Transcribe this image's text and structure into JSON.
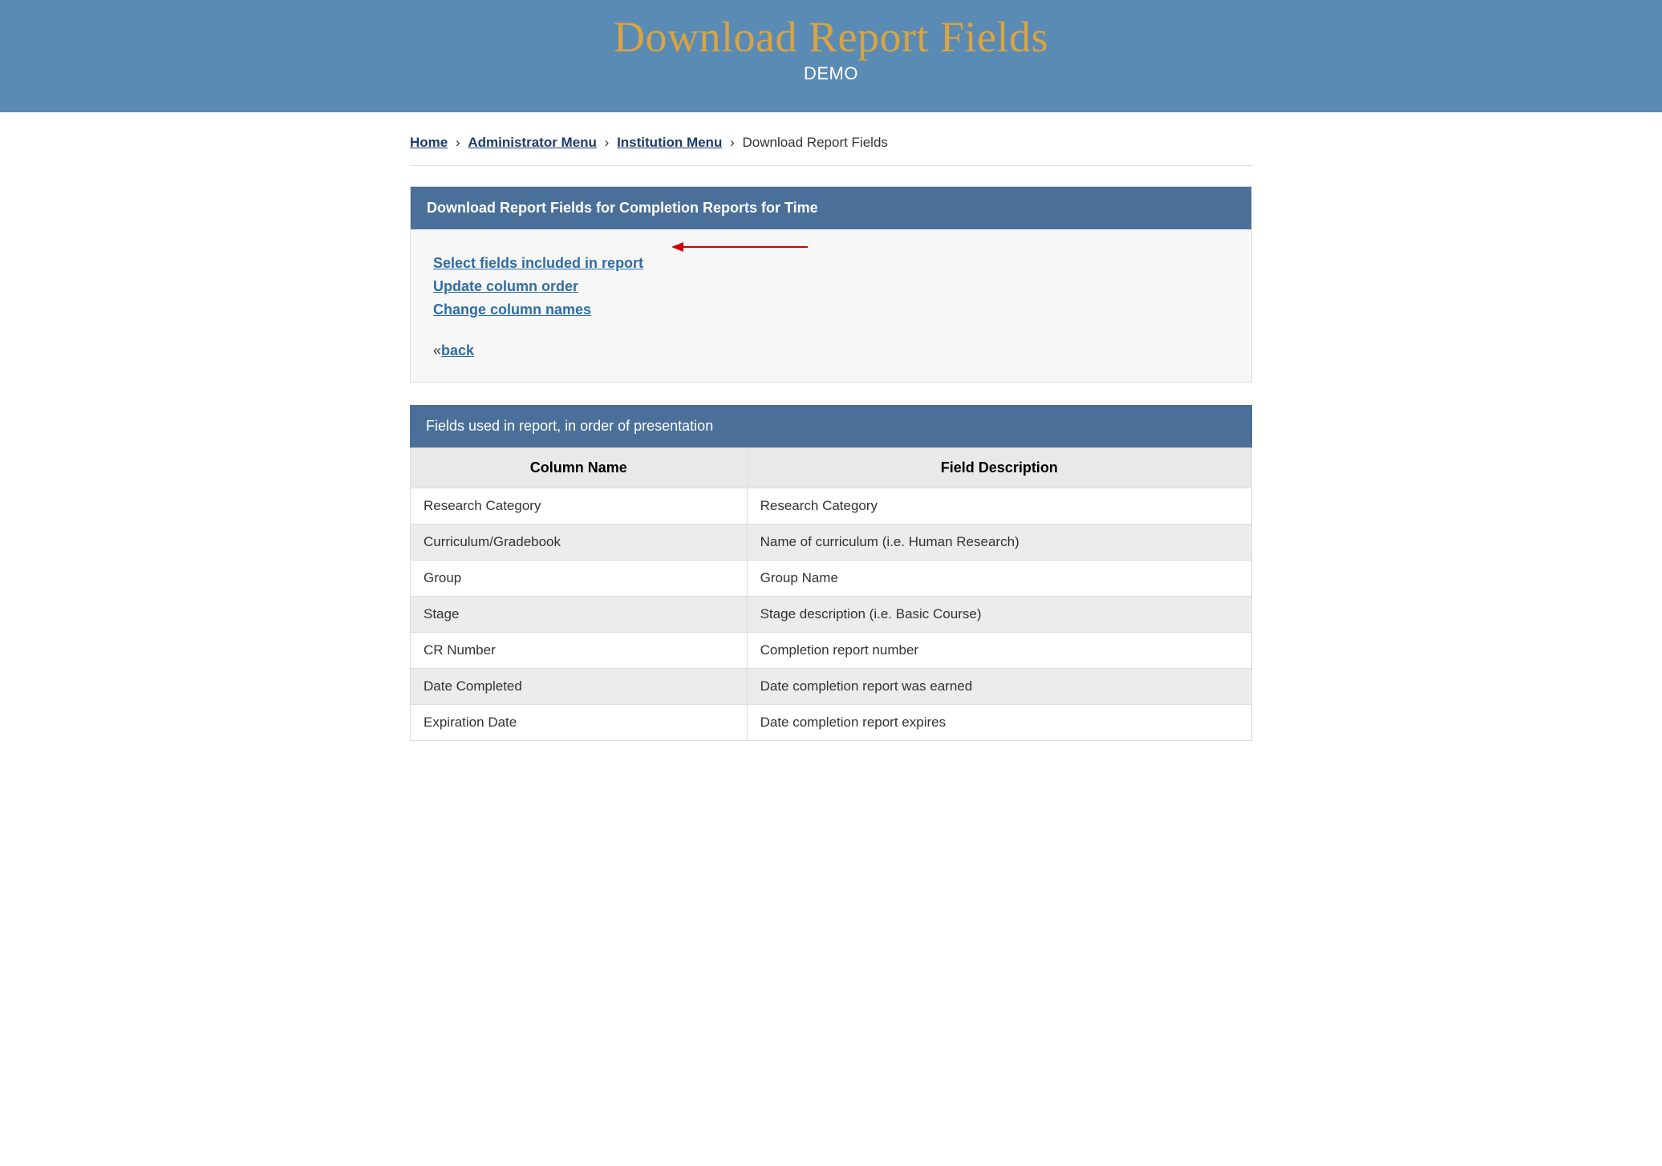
{
  "header": {
    "title": "Download Report Fields",
    "subtitle": "DEMO"
  },
  "breadcrumb": {
    "items": [
      {
        "label": "Home",
        "link": true
      },
      {
        "label": "Administrator Menu",
        "link": true
      },
      {
        "label": "Institution Menu",
        "link": true
      },
      {
        "label": "Download Report Fields",
        "link": false
      }
    ],
    "separator": "›"
  },
  "panel": {
    "title": "Download Report Fields for Completion Reports for Time",
    "actions": [
      "Select fields included in report",
      "Update column order",
      "Change column names"
    ],
    "back_prefix": "«",
    "back_label": "back"
  },
  "table_panel": {
    "title": "Fields used in report, in order of presentation",
    "columns": [
      "Column Name",
      "Field Description"
    ],
    "rows": [
      {
        "name": "Research Category",
        "desc": "Research Category"
      },
      {
        "name": "Curriculum/Gradebook",
        "desc": "Name of curriculum (i.e. Human Research)"
      },
      {
        "name": "Group",
        "desc": "Group Name"
      },
      {
        "name": "Stage",
        "desc": "Stage description (i.e. Basic Course)"
      },
      {
        "name": "CR Number",
        "desc": "Completion report number"
      },
      {
        "name": "Date Completed",
        "desc": "Date completion report was earned"
      },
      {
        "name": "Expiration Date",
        "desc": "Date completion report expires"
      }
    ]
  }
}
